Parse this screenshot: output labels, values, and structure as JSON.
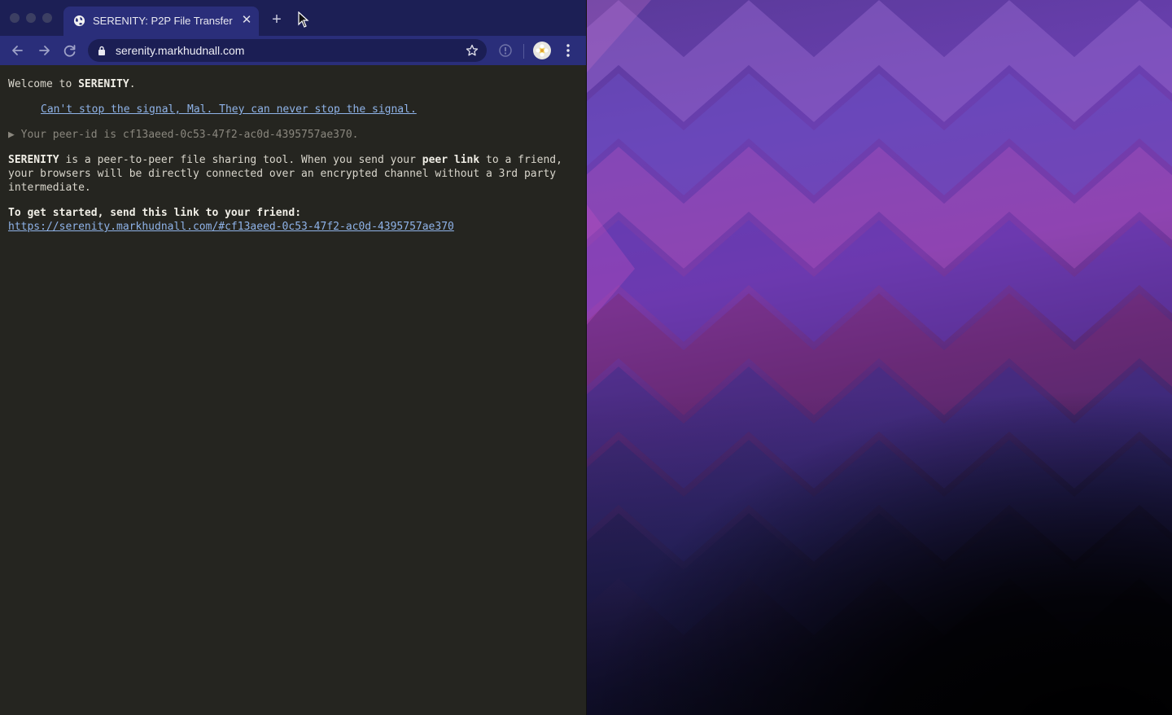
{
  "browser": {
    "tab": {
      "title": "SERENITY: P2P File Transfer",
      "close_glyph": "✕",
      "favicon": "globe-icon"
    },
    "new_tab_glyph": "+",
    "address_bar": {
      "url": "serenity.markhudnall.com",
      "secure_icon": "lock-icon"
    },
    "icons": {
      "back": "back-arrow-icon",
      "forward": "forward-arrow-icon",
      "reload": "reload-icon",
      "bookmark": "star-icon",
      "extension": "extension-icon",
      "profile": "avatar",
      "menu": "kebab-menu-icon"
    },
    "colors": {
      "tabstrip": "#1c1f55",
      "toolbar": "#2a2e7a",
      "page_bg": "#252520",
      "link": "#8fb3e8"
    }
  },
  "page": {
    "welcome_prefix": "Welcome to ",
    "welcome_name": "SERENITY",
    "welcome_suffix": ".",
    "quote": "Can't stop the signal, Mal. They can never stop the signal.",
    "peer_toggle": "▶",
    "peer_text": "Your peer-id is cf13aeed-0c53-47f2-ac0d-4395757ae370.",
    "desc_name": "SERENITY",
    "desc_part1": " is a peer-to-peer file sharing tool. When you send your ",
    "desc_bold": "peer link",
    "desc_part2": " to a friend, your browsers will be directly connected over an encrypted channel without a 3rd party intermediate.",
    "start_text": "To get started, send this link to your friend:",
    "peer_link": "https://serenity.markhudnall.com/#cf13aeed-0c53-47f2-ac0d-4395757ae370"
  }
}
